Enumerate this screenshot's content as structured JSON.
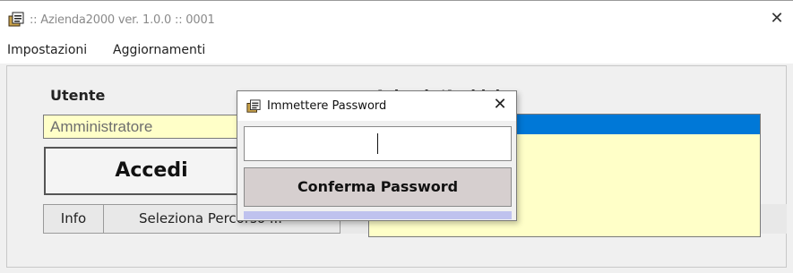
{
  "window": {
    "title": ":: Azienda2000  ver. 1.0.0 :: 0001",
    "close_glyph": "✕",
    "icon": "app-icon"
  },
  "menu": {
    "items": [
      {
        "label": "Impostazioni"
      },
      {
        "label": "Aggiornamenti"
      }
    ]
  },
  "login": {
    "user_label": "Utente",
    "user_value": "Amministratore",
    "accedi_label": "Accedi",
    "info_label": "Info",
    "select_path_label": "Seleziona Percorso ..."
  },
  "right_panel": {
    "label_partial": "Aziende/Archivi"
  },
  "dialog": {
    "title": "Immettere Password",
    "close_glyph": "✕",
    "password_value": "",
    "confirm_label": "Conferma Password",
    "icon": "app-icon"
  },
  "colors": {
    "field_bg": "#ffffc8",
    "selection": "#0078d7",
    "confirm_bg": "#d6cfcf",
    "dialog_strip": "#bfc2ee"
  }
}
